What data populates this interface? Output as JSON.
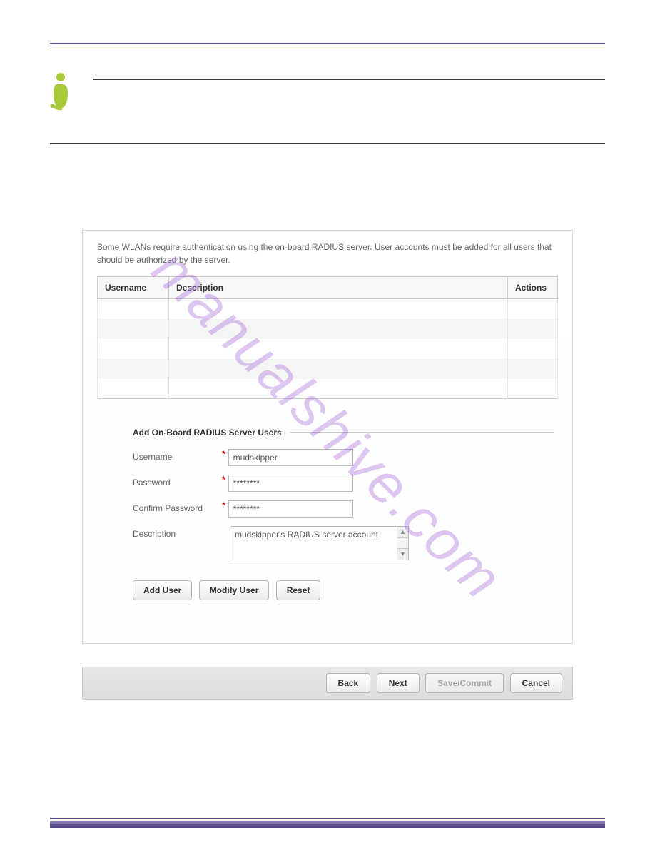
{
  "watermark": "manualshive.com",
  "panel": {
    "intro": "Some WLANs require authentication using the on-board RADIUS server.  User accounts must be added for all users that should be authorized by the server.",
    "table": {
      "headers": {
        "username": "Username",
        "description": "Description",
        "actions": "Actions"
      }
    },
    "form": {
      "title": "Add On-Board RADIUS Server Users",
      "labels": {
        "username": "Username",
        "password": "Password",
        "confirm": "Confirm Password",
        "description": "Description"
      },
      "values": {
        "username": "mudskipper",
        "password": "********",
        "confirm": "********",
        "description": "mudskipper's RADIUS server account"
      }
    },
    "buttons": {
      "add": "Add User",
      "modify": "Modify User",
      "reset": "Reset"
    }
  },
  "footer": {
    "back": "Back",
    "next": "Next",
    "save": "Save/Commit",
    "cancel": "Cancel"
  }
}
